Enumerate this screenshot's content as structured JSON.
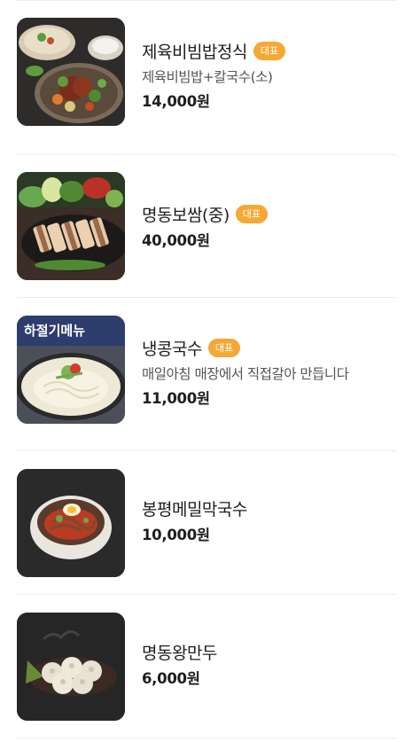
{
  "menu": {
    "items": [
      {
        "name": "제육비빔밥정식",
        "badge": "대표",
        "description": "제육비빔밥+칼국수(소)",
        "price": "14,000원",
        "image_icon": "bibimbap-set-photo"
      },
      {
        "name": "명동보쌈(중)",
        "badge": "대표",
        "description": "",
        "price": "40,000원",
        "image_icon": "bossam-photo"
      },
      {
        "name": "냉콩국수",
        "badge": "대표",
        "description": "매일아침 매장에서 직접갈아 만듭니다",
        "price": "11,000원",
        "image_icon": "kongguksu-photo",
        "image_banner": "하절기메뉴"
      },
      {
        "name": "봉평메밀막국수",
        "badge": "",
        "description": "",
        "price": "10,000원",
        "image_icon": "makguksu-photo"
      },
      {
        "name": "명동왕만두",
        "badge": "",
        "description": "",
        "price": "6,000원",
        "image_icon": "mandu-photo"
      }
    ]
  },
  "colors": {
    "badge_bg": "#f5a834",
    "text_primary": "#1e1e1e",
    "text_secondary": "#555555",
    "divider": "#ececec"
  }
}
